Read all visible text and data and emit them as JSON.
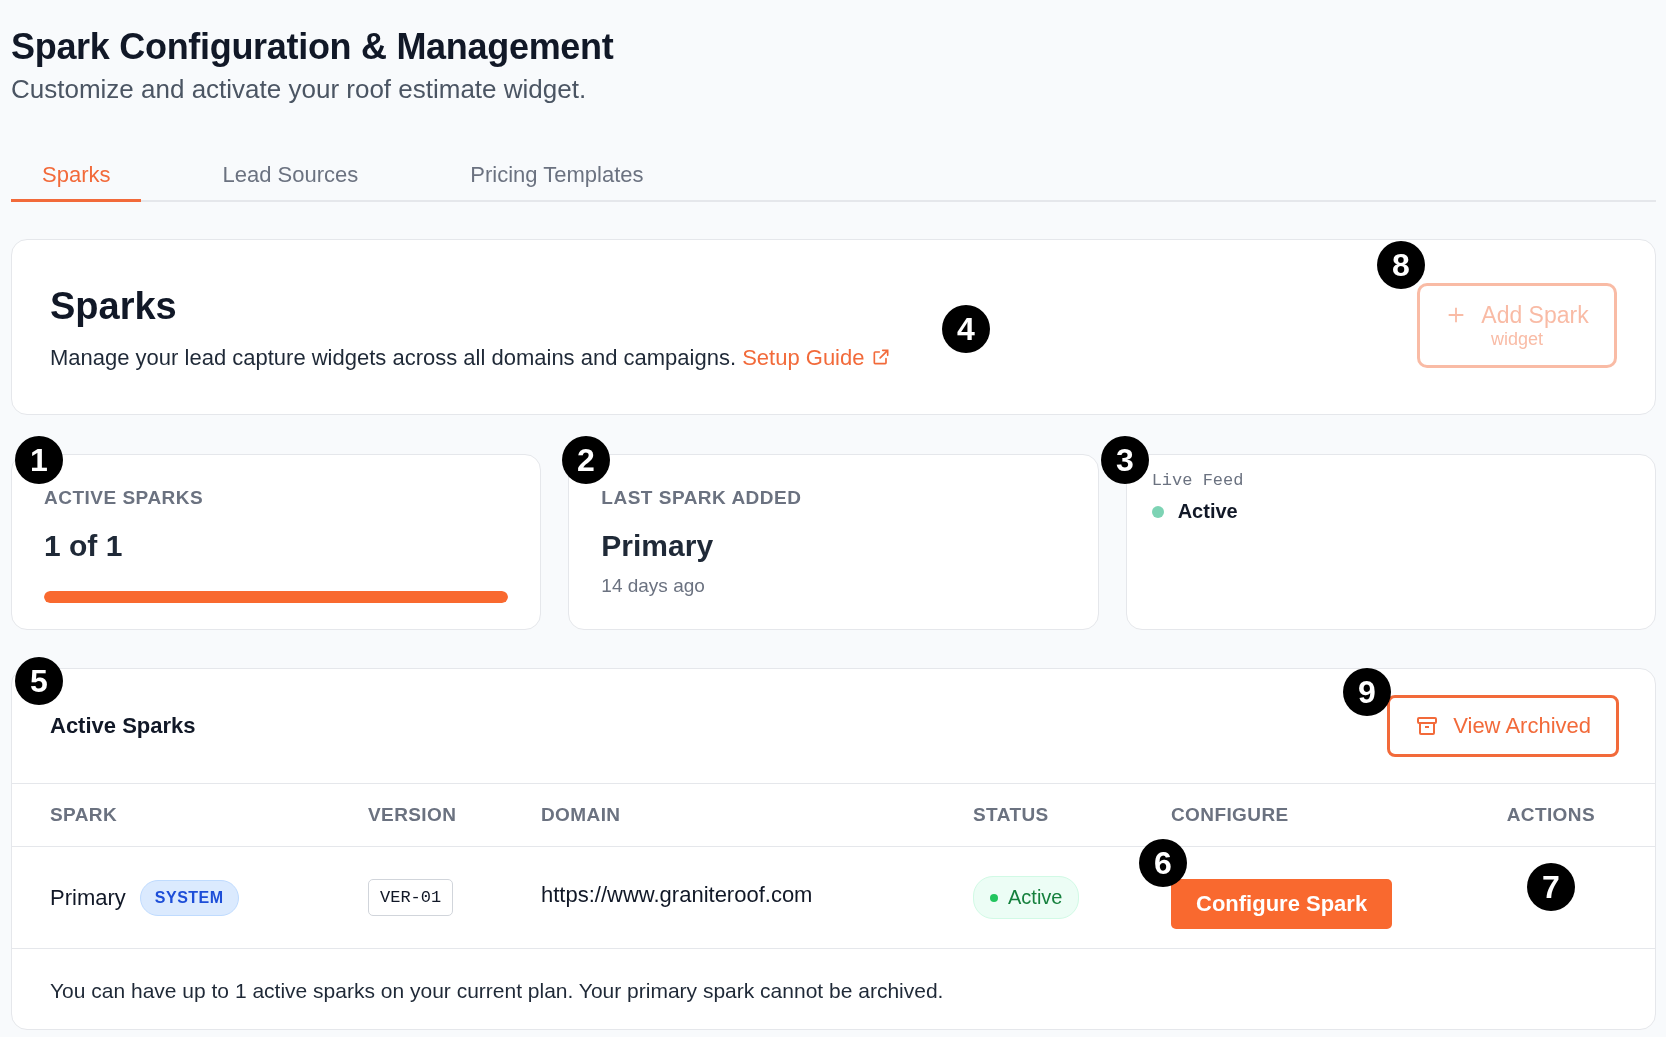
{
  "header": {
    "title": "Spark Configuration & Management",
    "subtitle": "Customize and activate your roof estimate widget."
  },
  "tabs": [
    {
      "label": "Sparks",
      "selected": true
    },
    {
      "label": "Lead Sources",
      "selected": false
    },
    {
      "label": "Pricing Templates",
      "selected": false
    }
  ],
  "intro_card": {
    "title": "Sparks",
    "description": "Manage your lead capture widgets across all domains and campaigns.",
    "link": "Setup Guide",
    "add_button": {
      "label": "Add Spark",
      "sublabel": "widget",
      "disabled": true
    }
  },
  "stats": [
    {
      "kind": "progress",
      "label": "ACTIVE SPARKS",
      "value": "1 of 1",
      "level": 1
    },
    {
      "kind": "text",
      "label": "LAST SPARK ADDED",
      "value": "Primary",
      "note": "14 days ago"
    },
    {
      "kind": "feed",
      "label": "Live Feed",
      "status": "Active",
      "color": "#7dd3b4"
    }
  ],
  "table": {
    "title": "Active Sparks",
    "archive_button": "View Archived",
    "columns": [
      "SPARK",
      "VERSION",
      "DOMAIN",
      "STATUS",
      "CONFIGURE",
      "ACTIONS"
    ],
    "rows": [
      {
        "spark": "Primary",
        "badge": "SYSTEM",
        "version": "VER-01",
        "domain": "https://www.graniteroof.com",
        "status": "Active",
        "configure": "Configure Spark"
      }
    ],
    "footer": "You can have up to 1 active sparks on your current plan. Your primary spark cannot be archived."
  },
  "callouts": [
    "1",
    "2",
    "3",
    "4",
    "5",
    "6",
    "7",
    "8",
    "9"
  ]
}
